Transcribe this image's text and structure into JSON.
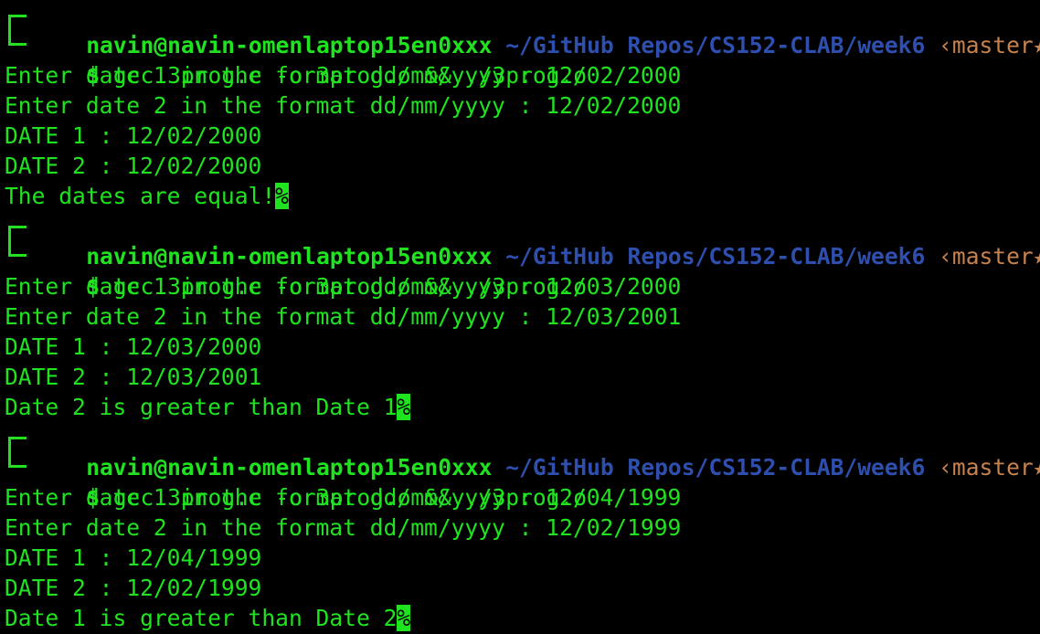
{
  "blocks": [
    {
      "prompt": {
        "user": "navin@navin-omenlaptop15en0xxx",
        "path": "~/GitHub Repos/CS152-CLAB/week6",
        "git": "‹master★›",
        "symbol": "$",
        "command": "gcc 3prog.c -o 3prog.o && ./3prog.o"
      },
      "output": [
        "Enter date 1 in the format dd/mm/yyyy : 12/02/2000",
        "Enter date 2 in the format dd/mm/yyyy : 12/02/2000",
        "DATE 1 : 12/02/2000",
        "DATE 2 : 12/02/2000"
      ],
      "last_line": "The dates are equal!",
      "eol_mark": "%"
    },
    {
      "prompt": {
        "user": "navin@navin-omenlaptop15en0xxx",
        "path": "~/GitHub Repos/CS152-CLAB/week6",
        "git": "‹master★›",
        "symbol": "$",
        "command": "gcc 3prog.c -o 3prog.o && ./3prog.o"
      },
      "output": [
        "Enter date 1 in the format dd/mm/yyyy : 12/03/2000",
        "Enter date 2 in the format dd/mm/yyyy : 12/03/2001",
        "DATE 1 : 12/03/2000",
        "DATE 2 : 12/03/2001"
      ],
      "last_line": "Date 2 is greater than Date 1",
      "eol_mark": "%"
    },
    {
      "prompt": {
        "user": "navin@navin-omenlaptop15en0xxx",
        "path": "~/GitHub Repos/CS152-CLAB/week6",
        "git": "‹master★›",
        "symbol": "$",
        "command": "gcc 3prog.c -o 3prog.o && ./3prog.o"
      },
      "output": [
        "Enter date 1 in the format dd/mm/yyyy : 12/04/1999",
        "Enter date 2 in the format dd/mm/yyyy : 12/02/1999",
        "DATE 1 : 12/04/1999",
        "DATE 2 : 12/02/1999"
      ],
      "last_line": "Date 1 is greater than Date 2",
      "eol_mark": "%"
    }
  ],
  "colors": {
    "background": "#000000",
    "green": "#1fe31f",
    "path_blue": "#2f4fae",
    "git_orange": "#c8824e"
  }
}
